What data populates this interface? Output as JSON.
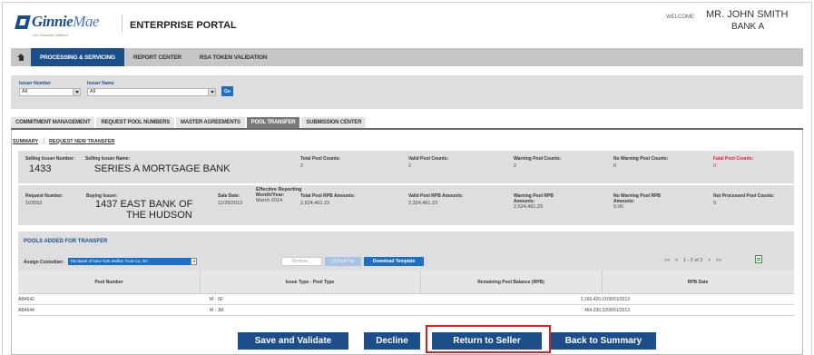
{
  "header": {
    "logo_text_1": "Ginnie",
    "logo_text_2": "Mae",
    "logo_tagline": "Our Guaranty Matters",
    "portal_title": "ENTERPRISE PORTAL",
    "welcome_label": "WELCOME",
    "user_name": "MR. JOHN SMITH",
    "user_bank": "BANK A"
  },
  "topnav": {
    "items": [
      {
        "label": "PROCESSING & SERVICING",
        "active": true
      },
      {
        "label": "REPORT CENTER",
        "active": false
      },
      {
        "label": "RSA TOKEN VALIDATION",
        "active": false
      }
    ]
  },
  "filter": {
    "issuer_number_label": "Issuer Number",
    "issuer_number_value": "All",
    "issuer_name_label": "Issuer Name",
    "issuer_name_value": "All",
    "go_label": "Go"
  },
  "subtabs": [
    {
      "label": "COMMITMENT MANAGEMENT",
      "active": false
    },
    {
      "label": "REQUEST POOL NUMBERS",
      "active": false
    },
    {
      "label": "MASTER AGREEMENTS",
      "active": false
    },
    {
      "label": "POOL TRANSFER",
      "active": true
    },
    {
      "label": "SUBMISSION CENTER",
      "active": false
    }
  ],
  "links": {
    "summary": "SUMMARY",
    "request_new": "REQUEST NEW TRANSFER"
  },
  "summary_row1": {
    "selling_issuer_number_label": "Selling Issuer Number:",
    "selling_issuer_number": "1433",
    "selling_issuer_name_label": "Selling Issuer Name:",
    "selling_issuer_name": "SERIES A MORTGAGE BANK",
    "total_pool_counts_label": "Total Pool Counts:",
    "total_pool_counts": "2",
    "valid_pool_counts_label": "Valid Pool Counts:",
    "valid_pool_counts": "2",
    "warning_pool_counts_label": "Warning Pool Counts:",
    "warning_pool_counts": "2",
    "no_warning_pool_counts_label": "No Warning Pool Counts:",
    "no_warning_pool_counts": "0",
    "fatal_pool_counts_label": "Fatal Pool Counts:",
    "fatal_pool_counts": "0"
  },
  "summary_row2": {
    "request_number_label": "Request Number:",
    "request_number": "103553",
    "buying_issuer_label": "Buying Issuer:",
    "buying_issuer_line1": "1437 EAST BANK OF",
    "buying_issuer_line2": "THE HUDSON",
    "sale_date_label": "Sale Date:",
    "sale_date": "11/29/2013",
    "effective_label_1": "Effective Reporting",
    "effective_label_2": "Month/Year:",
    "effective_value": "March 2014",
    "total_rpb_label": "Total Pool RPB Amounts:",
    "total_rpb": "2,624,461.23",
    "valid_rpb_label": "Valid Pool RPB Amounts:",
    "valid_rpb": "2,324,461.23",
    "warning_rpb_label_1": "Warning Pool RPB",
    "warning_rpb_label_2": "Amounts:",
    "warning_rpb": "2,624,461.23",
    "no_warning_rpb_label_1": "No Warning Pool RPB",
    "no_warning_rpb_label_2": "Amounts:",
    "no_warning_rpb": "0.00",
    "not_processed_label": "Not Processed Pool Counts:",
    "not_processed": "0"
  },
  "pools": {
    "title": "POOLS ADDED FOR TRANSFER",
    "assign_custodian_label": "Assign Custodian:",
    "custodian_value": "The Bank of New York Mellon Trust Co, NA",
    "browse_label": "Browse...",
    "upload_label": "Upload File",
    "download_label": "Download Template",
    "pager": {
      "first": "<<",
      "prev": "<",
      "status": "1 - 2 of 2",
      "next": ">",
      "last": ">>"
    }
  },
  "table": {
    "columns": [
      "Pool Number",
      "Issue Type - Pool Type",
      "Remaining Pool Balance (RPB)",
      "RPB Date"
    ],
    "rows": [
      {
        "pool_number": "AB4642",
        "issue_type": "M - SF",
        "rpb": "2,160,420.01",
        "rpb_date": "09/01/2013"
      },
      {
        "pool_number": "AB4644",
        "issue_type": "M - JM",
        "rpb": "464,030.22",
        "rpb_date": "09/01/2013"
      }
    ]
  },
  "actions": {
    "save_validate": "Save and Validate",
    "decline": "Decline",
    "return_to_seller": "Return to Seller",
    "back_to_summary": "Back to Summary"
  },
  "colors": {
    "brand_blue": "#1c4e8c",
    "accent_blue": "#1c6fc7",
    "fatal_red": "#e0203a",
    "highlight_red": "#e02020"
  }
}
